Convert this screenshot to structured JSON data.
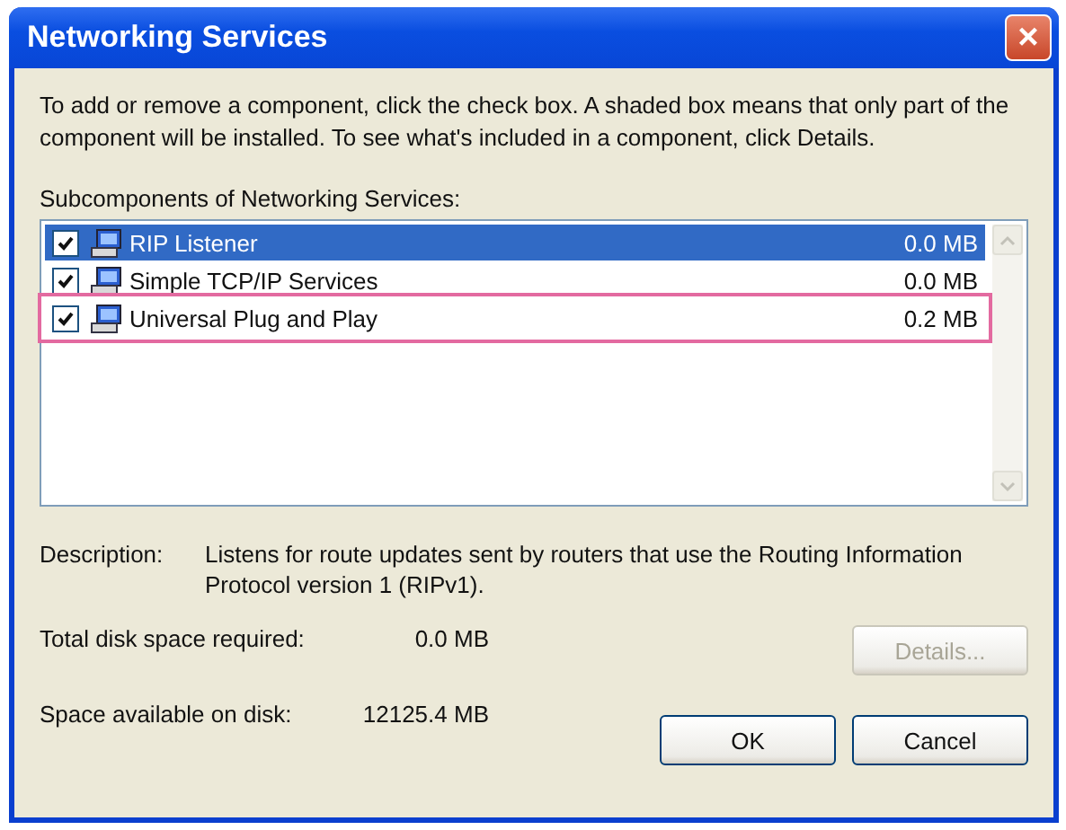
{
  "window": {
    "title": "Networking Services",
    "close": "×"
  },
  "instructions": "To add or remove a component, click the check box. A shaded box means that only part of the component will be installed. To see what's included in a component, click Details.",
  "list_label": "Subcomponents of Networking Services:",
  "components": [
    {
      "name": "RIP Listener",
      "size": "0.0 MB",
      "checked": true,
      "selected": true,
      "highlighted": false
    },
    {
      "name": "Simple TCP/IP Services",
      "size": "0.0 MB",
      "checked": true,
      "selected": false,
      "highlighted": false
    },
    {
      "name": "Universal Plug and Play",
      "size": "0.2 MB",
      "checked": true,
      "selected": false,
      "highlighted": true
    }
  ],
  "description": {
    "label": "Description:",
    "text": "Listens for route updates sent by routers that use the Routing Information Protocol version 1 (RIPv1)."
  },
  "disk": [
    {
      "label": "Total disk space required:",
      "value": "0.0 MB"
    },
    {
      "label": "Space available on disk:",
      "value": "12125.4 MB"
    }
  ],
  "buttons": [
    {
      "kind": "details",
      "label": "Details...",
      "disabled": true
    },
    {
      "kind": "ok",
      "label": "OK",
      "disabled": false
    },
    {
      "kind": "cancel",
      "label": "Cancel",
      "disabled": false
    }
  ]
}
